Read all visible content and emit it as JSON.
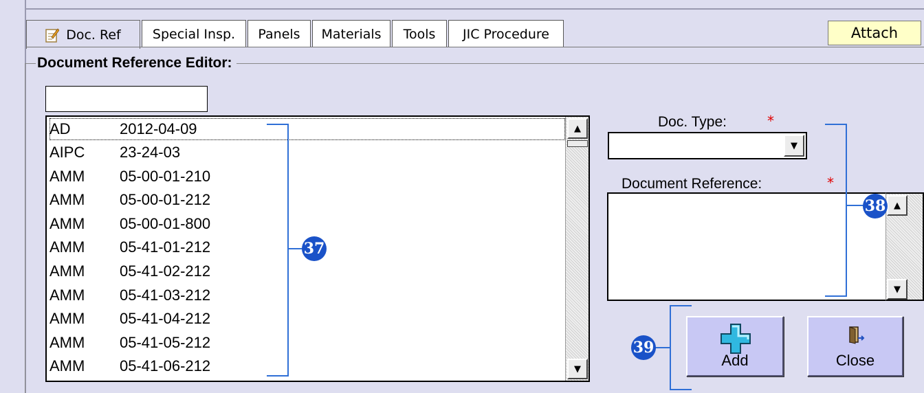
{
  "tabs": [
    {
      "label": "Doc. Ref",
      "active": true,
      "icon": "edit-note-icon"
    },
    {
      "label": "Special Insp."
    },
    {
      "label": "Panels"
    },
    {
      "label": "Materials"
    },
    {
      "label": "Tools"
    },
    {
      "label": "JIC Procedure"
    }
  ],
  "attach_label": "Attach",
  "editor": {
    "title": "Document Reference Editor:",
    "filter_value": "",
    "rows": [
      {
        "type": "AD",
        "ref": "2012-04-09"
      },
      {
        "type": "AIPC",
        "ref": "23-24-03"
      },
      {
        "type": "AMM",
        "ref": "05-00-01-210"
      },
      {
        "type": "AMM",
        "ref": "05-00-01-212"
      },
      {
        "type": "AMM",
        "ref": "05-00-01-800"
      },
      {
        "type": "AMM",
        "ref": "05-41-01-212"
      },
      {
        "type": "AMM",
        "ref": "05-41-02-212"
      },
      {
        "type": "AMM",
        "ref": "05-41-03-212"
      },
      {
        "type": "AMM",
        "ref": "05-41-04-212"
      },
      {
        "type": "AMM",
        "ref": "05-41-05-212"
      },
      {
        "type": "AMM",
        "ref": "05-41-06-212"
      }
    ],
    "doc_type_label": "Doc. Type:",
    "doc_type_value": "",
    "doc_ref_label": "Document Reference:",
    "required_mark": "*",
    "add_label": "Add",
    "close_label": "Close"
  },
  "callouts": {
    "c37": "37",
    "c38": "38",
    "c39": "39"
  },
  "colors": {
    "background": "#dedef0",
    "button": "#c8c8f4",
    "attach": "#ffffc8",
    "callout": "#1a52c8",
    "required": "#e00000"
  }
}
